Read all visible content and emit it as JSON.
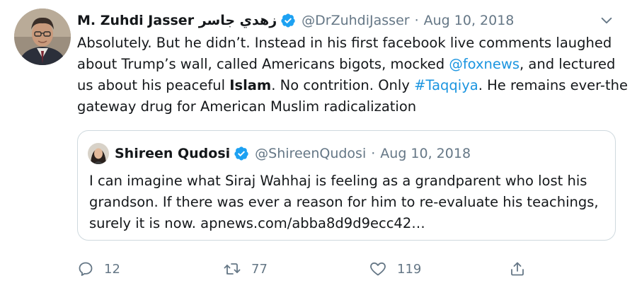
{
  "tweet": {
    "author": {
      "name": "M. Zuhdi Jasser زهدي جاسر",
      "handle": "@DrZuhdiJasser",
      "verified": true
    },
    "separator": "·",
    "date": "Aug 10, 2018",
    "body": {
      "t1": "Absolutely. But he didn’t. Instead in his first facebook live comments laughed about Trump’s wall, called Americans bigots, mocked ",
      "mention": "@foxnews",
      "t2": ", and lectured us about his peaceful ",
      "bold": "Islam",
      "t3": ". No contrition. Only ",
      "hashtag": "#Taqqiya",
      "t4": ". He remains ever-the gateway drug for American Muslim radicalization"
    },
    "quoted": {
      "author": {
        "name": "Shireen Qudosi",
        "handle": "@ShireenQudosi",
        "verified": true
      },
      "separator": "·",
      "date": "Aug 10, 2018",
      "text": "I can imagine what Siraj Wahhaj is feeling as a grandparent who lost his grandson. If there was ever a reason for him to re-evaluate his teachings, surely it is now. apnews.com/abba8d9d9ecc42…"
    },
    "actions": {
      "replies": "12",
      "retweets": "77",
      "likes": "119"
    },
    "icons": {
      "verified": "verified-badge-icon",
      "caret": "chevron-down-icon",
      "reply": "reply-icon",
      "retweet": "retweet-icon",
      "like": "heart-icon",
      "share": "share-icon"
    },
    "colors": {
      "link": "#1b95e0",
      "verified": "#1da1f2",
      "muted": "#657786",
      "text": "#14171a",
      "border": "#cfd9de"
    }
  }
}
